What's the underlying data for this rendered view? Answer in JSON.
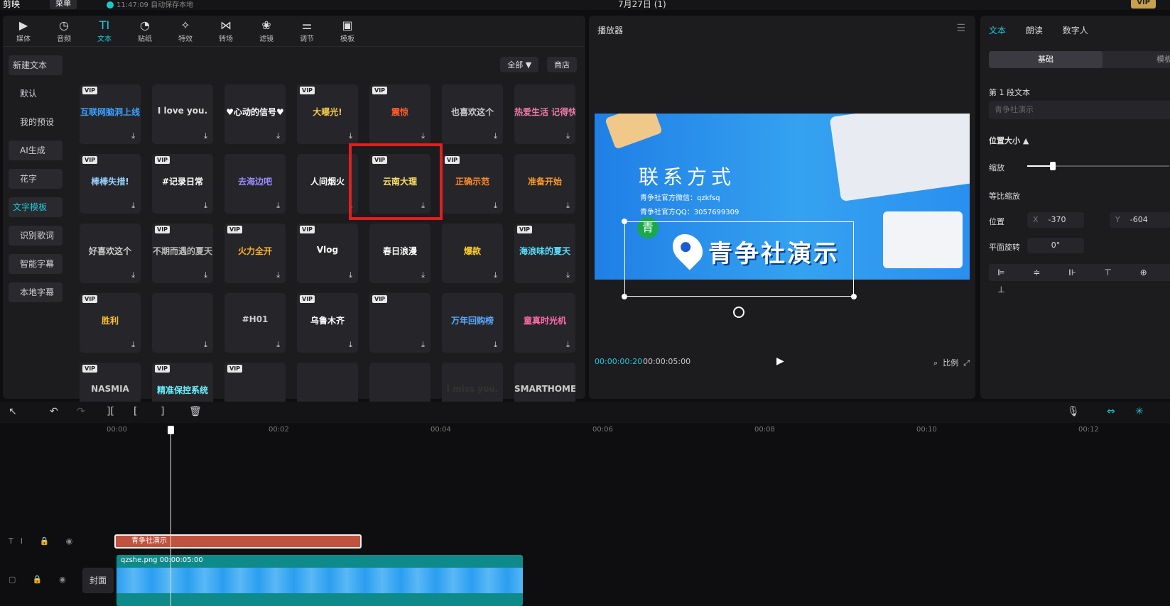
{
  "topbar": {
    "logo": "剪映",
    "menu": "菜单",
    "save_status": "11:47:09 自动保存本地",
    "project_title": "7月27日 (1)",
    "vip": "VIP"
  },
  "toolbar": [
    {
      "label": "媒体",
      "icon": "▶"
    },
    {
      "label": "音频",
      "icon": "◷"
    },
    {
      "label": "文本",
      "icon": "TI"
    },
    {
      "label": "贴纸",
      "icon": "◔"
    },
    {
      "label": "特效",
      "icon": "✧"
    },
    {
      "label": "转场",
      "icon": "⋈"
    },
    {
      "label": "滤镜",
      "icon": "❀"
    },
    {
      "label": "调节",
      "icon": "⚌"
    },
    {
      "label": "模板",
      "icon": "▣"
    }
  ],
  "sidebar": [
    "新建文本",
    "默认",
    "我的预设",
    "AI生成",
    "花字",
    "文字模板",
    "识别歌词",
    "智能字幕",
    "本地字幕"
  ],
  "filters": {
    "all": "全部 ▼",
    "store": "商店"
  },
  "templates": [
    [
      {
        "vip": true,
        "t": "互联网脑洞上线",
        "c": "#3aa0ff"
      },
      {
        "vip": false,
        "t": "I love you.",
        "c": "#ddd"
      },
      {
        "vip": false,
        "t": "♥心动的信号♥",
        "c": "#fff"
      },
      {
        "vip": true,
        "t": "大曝光!",
        "c": "#f5c84a"
      },
      {
        "vip": true,
        "t": "震惊",
        "c": "#ff5a2a"
      },
      {
        "vip": false,
        "t": "也喜欢这个",
        "c": "#ccc"
      },
      {
        "vip": false,
        "t": "热爱生活 记得快乐",
        "c": "#f07aa8"
      }
    ],
    [
      {
        "vip": true,
        "t": "棒棒失措!",
        "c": "#9ad0ff"
      },
      {
        "vip": true,
        "t": "#记录日常",
        "c": "#fff"
      },
      {
        "vip": false,
        "t": "去海边吧",
        "c": "#9a8cff"
      },
      {
        "vip": false,
        "t": "人间烟火",
        "c": "#fff"
      },
      {
        "vip": true,
        "t": "云南大理",
        "c": "#ffe066"
      },
      {
        "vip": true,
        "t": "正确示范",
        "c": "#ff8a2a"
      },
      {
        "vip": false,
        "t": "准备开始",
        "c": "#ff9a2a"
      }
    ],
    [
      {
        "vip": false,
        "t": "好喜欢这个",
        "c": "#ccc"
      },
      {
        "vip": true,
        "t": "不期而遇的夏天",
        "c": "#bbb"
      },
      {
        "vip": true,
        "t": "火力全开",
        "c": "#ffb02a"
      },
      {
        "vip": true,
        "t": "Vlog",
        "c": "#fff"
      },
      {
        "vip": false,
        "t": "春日浪漫",
        "c": "#fff"
      },
      {
        "vip": false,
        "t": "爆款",
        "c": "#ffd02a"
      },
      {
        "vip": true,
        "t": "海浪味的夏天",
        "c": "#5ae0ff"
      }
    ],
    [
      {
        "vip": true,
        "t": "胜利",
        "c": "#ffc02a"
      },
      {
        "vip": false,
        "t": "",
        "c": "#fff"
      },
      {
        "vip": false,
        "t": "#H01",
        "c": "#ccc"
      },
      {
        "vip": true,
        "t": "乌鲁木齐",
        "c": "#fff"
      },
      {
        "vip": true,
        "t": "",
        "c": "#fff"
      },
      {
        "vip": false,
        "t": "万年回购榜",
        "c": "#5aa8ff"
      },
      {
        "vip": false,
        "t": "童真时光机",
        "c": "#ff6aa8"
      }
    ],
    [
      {
        "vip": true,
        "t": "NASMIA",
        "c": "#ccc"
      },
      {
        "vip": true,
        "t": "精准保控系统",
        "c": "#6af0ff"
      },
      {
        "vip": true,
        "t": "",
        "c": "#5aa0ff"
      },
      {
        "vip": false,
        "t": "",
        "c": "#fff"
      },
      {
        "vip": false,
        "t": "",
        "c": "#ff9ac8"
      },
      {
        "vip": false,
        "t": "I miss you.",
        "c": "#333"
      },
      {
        "vip": false,
        "t": "SMARTHOME",
        "c": "#ccc"
      }
    ]
  ],
  "player": {
    "title": "播放器",
    "contact": "联系方式",
    "wechat": "青争社官方微信：qzkfsq",
    "qq": "青争社官方QQ：3057699309",
    "main_text": "青争社演示",
    "qing": "青",
    "current_time": "00:00:00:20",
    "total_time": "00:00:05:00",
    "ratio": "比例"
  },
  "props": {
    "tabs": [
      "文本",
      "朗读",
      "数字人"
    ],
    "seg_on": "基础",
    "seg_off": "模板",
    "para_label": "第 1 段文本",
    "para_value": "青争社演示",
    "pos_size": "位置大小 ▲",
    "scale": "缩放",
    "scale_value": 0.18,
    "uniform": "等比缩放",
    "position": "位置",
    "x_axis": "X",
    "x_val": "-370",
    "y_axis": "Y",
    "y_val": "-604",
    "rotation": "平面旋转",
    "rot_val": "0°",
    "aligns": "⊫ ≑ ⊪ ⊤ ⊕ ⊥"
  },
  "timeline": {
    "ticks": [
      "00:00",
      "00:02",
      "00:04",
      "00:06",
      "00:08",
      "00:10",
      "00:12"
    ],
    "text_clip": "青争社演示",
    "video_clip": "qzshe.png  00:00:05:00",
    "cover": "封面",
    "text_track_ctl": "TI 🔒 ◉",
    "video_track_ctl": "▢ 🔒 ◉ ◀)"
  }
}
